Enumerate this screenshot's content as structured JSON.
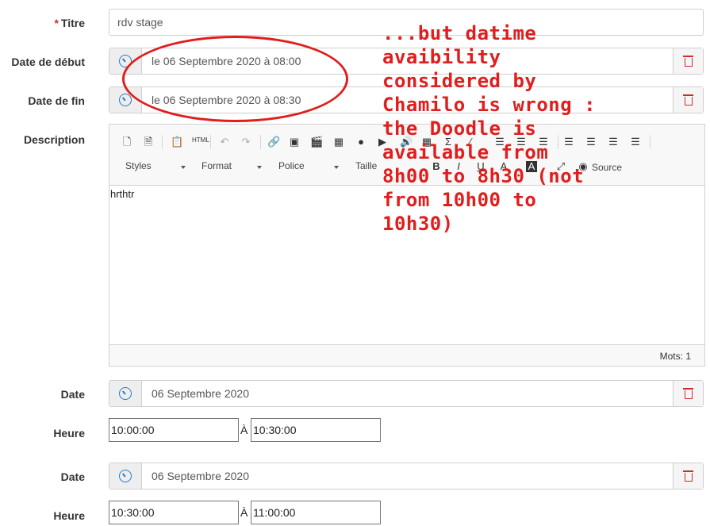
{
  "form": {
    "title_label": "Titre",
    "required_mark": "*",
    "title_value": "rdv stage",
    "start_label": "Date de début",
    "start_value": "le 06 Septembre 2020 à 08:00",
    "end_label": "Date de fin",
    "end_value": "le 06 Septembre 2020 à 08:30",
    "description_label": "Description"
  },
  "editor": {
    "combos": [
      "Styles",
      "Format",
      "Police",
      "Taille"
    ],
    "source_label": "Source",
    "content": "hrthtr",
    "word_count": "Mots: 1",
    "icons": {
      "new": "new-page-icon",
      "templates": "templates-icon",
      "paste": "paste-icon",
      "paste_html": "paste-html-icon",
      "undo": "undo-icon",
      "redo": "redo-icon",
      "link": "link-icon",
      "image": "image-icon",
      "video": "video-icon",
      "flash": "flash-icon",
      "youtube": "youtube-icon",
      "audio": "audio-icon",
      "table": "table-icon",
      "math": "math-icon",
      "bold": "B",
      "italic": "I",
      "underline": "U",
      "text_color": "A",
      "bg_color": "A",
      "maximize": "maximize-icon"
    }
  },
  "slots": [
    {
      "date_label": "Date",
      "date_value": "06 Septembre 2020",
      "time_label": "Heure",
      "time_start": "10:00:00",
      "sep": "À",
      "time_end": "10:30:00"
    },
    {
      "date_label": "Date",
      "date_value": "06 Septembre 2020",
      "time_label": "Heure",
      "time_start": "10:30:00",
      "sep": "À",
      "time_end": "11:00:00"
    }
  ],
  "annotation": {
    "text": "...but datime\navaibility\nconsidered by\nChamilo is wrong :\nthe Doodle is\navailable from\n8h00 to 8h30 (not\nfrom 10h00 to\n10h30)",
    "color": "#e01e1e"
  },
  "colors": {
    "clock": "#2a7bc0",
    "trash": "#c9302c",
    "required": "#c9302c"
  }
}
